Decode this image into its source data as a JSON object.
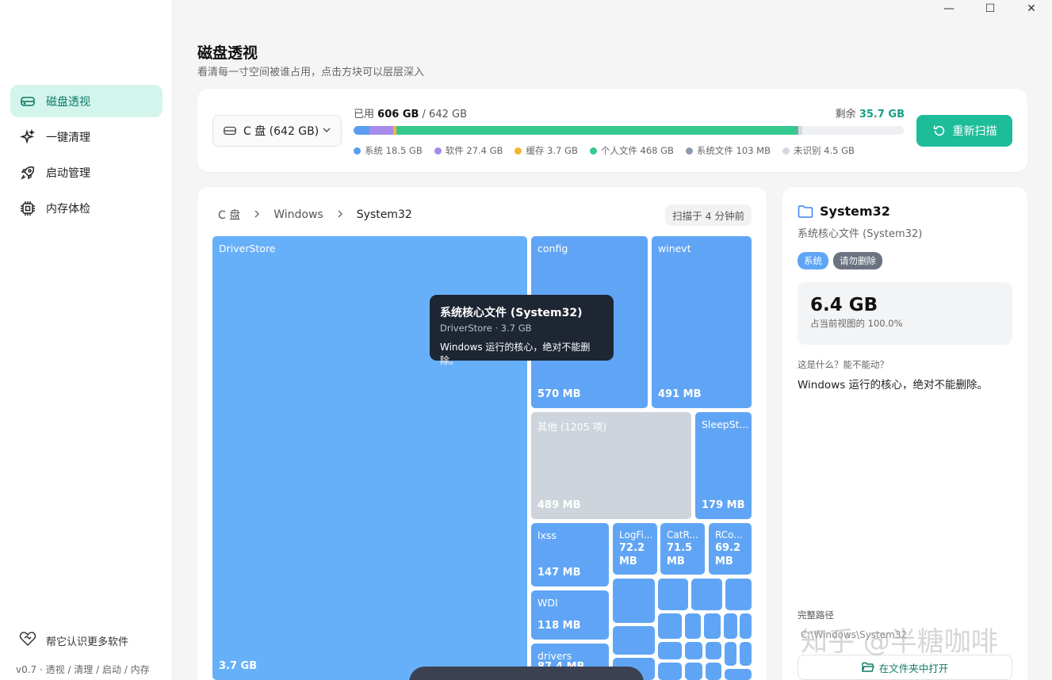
{
  "window": {
    "min": "—",
    "max": "☐",
    "close": "✕"
  },
  "sidebar": {
    "items": [
      {
        "label": "磁盘透视",
        "icon": "hard-drive-icon",
        "active": true
      },
      {
        "label": "一键清理",
        "icon": "sparkle-icon"
      },
      {
        "label": "启动管理",
        "icon": "rocket-icon"
      },
      {
        "label": "内存体检",
        "icon": "chip-icon"
      }
    ],
    "learn_more": "帮它认识更多软件",
    "version": "v0.7 · 透视 / 清理 / 启动 / 内存"
  },
  "header": {
    "title": "磁盘透视",
    "subtitle": "看清每一寸空间被谁占用，点击方块可以层层深入"
  },
  "disk": {
    "selected": "C 盘 (642 GB)",
    "used_prefix": "已用",
    "used": "606 GB",
    "total": "/ 642 GB",
    "remain_prefix": "剩余",
    "remain": "35.7 GB",
    "rescan_label": "重新扫描",
    "segments": [
      {
        "label": "系统 18.5 GB",
        "gb": 18.5,
        "color": "#5b9df0"
      },
      {
        "label": "软件 27.4 GB",
        "gb": 27.4,
        "color": "#a78bec"
      },
      {
        "label": "缓存 3.7 GB",
        "gb": 3.7,
        "color": "#f2b632"
      },
      {
        "label": "个人文件 468 GB",
        "gb": 468,
        "color": "#36c98e"
      },
      {
        "label": "系统文件 103 MB",
        "gb": 0.103,
        "color": "#8f9bb3"
      },
      {
        "label": "未识别 4.5 GB",
        "gb": 4.5,
        "color": "#d3d9e0"
      }
    ]
  },
  "treemap": {
    "breadcrumb": [
      "C 盘",
      "Windows",
      "System32"
    ],
    "scan_time": "扫描于 4 分钟前",
    "tiles": {
      "driverstore": {
        "name": "DriverStore",
        "size": "3.7 GB"
      },
      "config": {
        "name": "config",
        "size": "570 MB"
      },
      "winevt": {
        "name": "winevt",
        "size": "491 MB"
      },
      "other": {
        "name": "其他 (1205 项)",
        "size": "489 MB"
      },
      "sleepstudy": {
        "name": "SleepSt...",
        "size": "179 MB"
      },
      "lxss": {
        "name": "lxss",
        "size": "147 MB"
      },
      "logfiles": {
        "name": "LogFi...",
        "size": "72.2 MB"
      },
      "catroot": {
        "name": "CatR...",
        "size": "71.5 MB"
      },
      "rconfig": {
        "name": "RCo...",
        "size": "69.2 MB"
      },
      "wdi": {
        "name": "WDI",
        "size": "118 MB"
      },
      "drivers": {
        "name": "drivers",
        "size": "87.4 MB"
      }
    },
    "tooltip": {
      "title": "系统核心文件 (System32)",
      "meta": "DriverStore · 3.7 GB",
      "desc": "Windows 运行的核心，绝对不能删除。"
    }
  },
  "detail": {
    "title": "System32",
    "subtitle": "系统核心文件 (System32)",
    "tags": [
      {
        "label": "系统",
        "color": "#60a5f5"
      },
      {
        "label": "请勿删除",
        "color": "#6b7280"
      }
    ],
    "size": "6.4 GB",
    "share": "占当前视图的 100.0%",
    "question": "这是什么？能不能动？",
    "answer": "Windows 运行的核心，绝对不能删除。",
    "path_label": "完整路径",
    "path": "C:\\Windows\\System32",
    "open_label": "在文件夹中打开"
  },
  "watermark": "知乎 @半糖咖啡"
}
